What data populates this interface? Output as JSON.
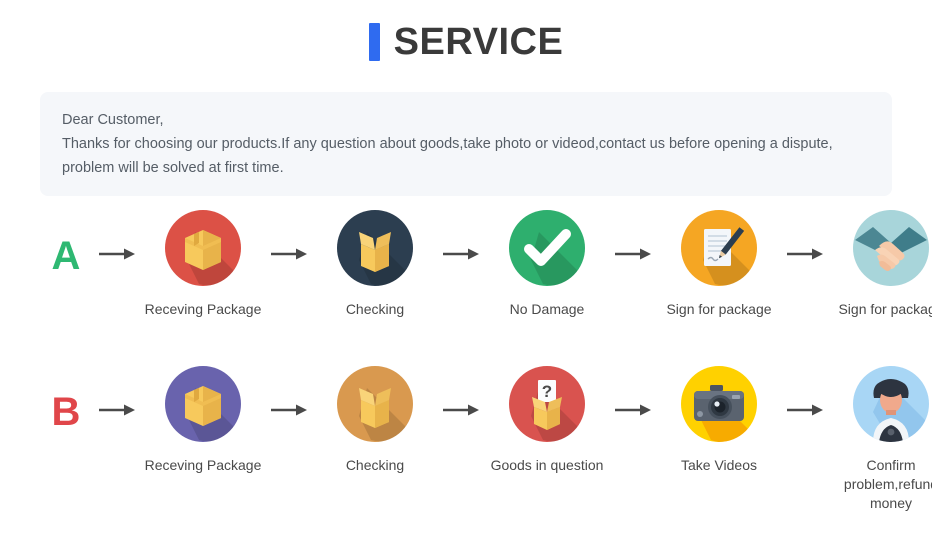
{
  "header": {
    "title": "SERVICE",
    "accent_color": "#2f6bf0"
  },
  "notice": {
    "line1": "Dear Customer,",
    "line2": "Thanks for choosing our products.If any question about goods,take photo or videod,contact us before opening a dispute,",
    "line3": "problem will be solved at first time.",
    "background_color": "#f5f7fa"
  },
  "flows": [
    {
      "letter": "A",
      "letter_color": "#2eb872",
      "steps": [
        {
          "icon": "package-box-icon",
          "label": "Receving Package",
          "circle_color": "#dc5146"
        },
        {
          "icon": "open-box-icon",
          "label": "Checking",
          "circle_color": "#2c3e50"
        },
        {
          "icon": "check-mark-icon",
          "label": "No Damage",
          "circle_color": "#2eaf6e"
        },
        {
          "icon": "document-pen-icon",
          "label": "Sign for package",
          "circle_color": "#f5a623"
        },
        {
          "icon": "handshake-icon",
          "label": "Sign for package",
          "circle_color": "#a8d5da"
        }
      ]
    },
    {
      "letter": "B",
      "letter_color": "#e0464a",
      "steps": [
        {
          "icon": "package-box-icon",
          "label": "Receving Package",
          "circle_color": "#6963ad"
        },
        {
          "icon": "open-box-icon",
          "label": "Checking",
          "circle_color": "#d9994f"
        },
        {
          "icon": "question-box-icon",
          "label": "Goods in question",
          "circle_color": "#d9534f"
        },
        {
          "icon": "camera-icon",
          "label": "Take Videos",
          "circle_color": "#ffd100"
        },
        {
          "icon": "support-person-icon",
          "label": "Confirm  problem,refund\nmoney",
          "circle_color": "#a8d6f5"
        }
      ]
    }
  ],
  "arrow": {
    "icon": "arrow-right-icon",
    "color": "#4a4a4a"
  }
}
